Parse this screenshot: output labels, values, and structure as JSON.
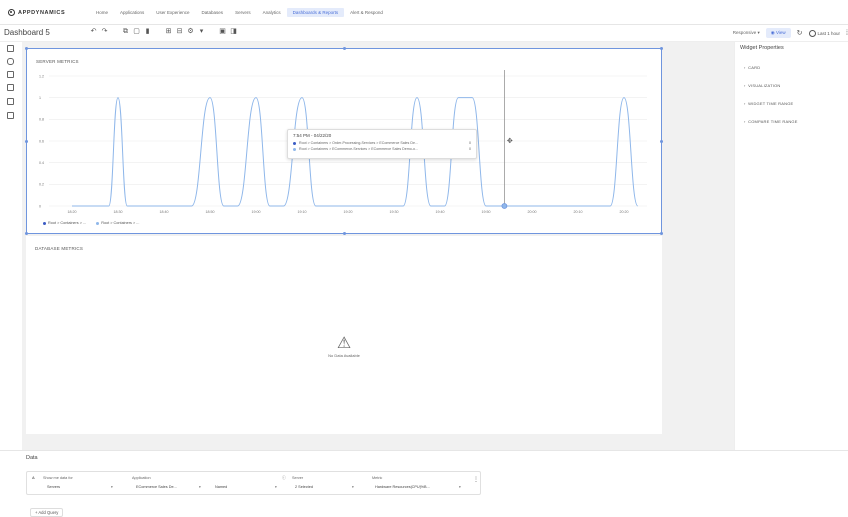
{
  "app": {
    "logo_text": "APPDYNAMICS"
  },
  "nav": {
    "items": [
      "Home",
      "Applications",
      "User Experience",
      "Databases",
      "Servers",
      "Analytics",
      "Dashboards & Reports",
      "Alert & Respond"
    ],
    "active_index": 6
  },
  "toolbar": {
    "dashboard_title": "Dashboard 5",
    "responsive_label": "Responsive",
    "view_label": "View",
    "timerange_label": "Last 1 hour"
  },
  "widgets": {
    "server": {
      "title": "SERVER METRICS",
      "tooltip": {
        "time": "7:54 PM - 04/22/20",
        "rows": [
          {
            "label": "Root > Containers > Order-Processing-Services > ECommerce Sales De...",
            "value": "0",
            "color": "#3b5cc4"
          },
          {
            "label": "Root > Containers > ECommerce-Services > ECommerce Sales Demo-o...",
            "value": "0",
            "color": "#8fb7ea"
          }
        ]
      },
      "legend": [
        {
          "label": "Root > Containers > ...",
          "color": "#3b5cc4"
        },
        {
          "label": "Root > Containers > ...",
          "color": "#8fb7ea"
        }
      ]
    },
    "database": {
      "title": "DATABASE METRICS",
      "no_data_text": "No Data Available"
    }
  },
  "chart_data": {
    "type": "line",
    "y_ticks": [
      "1.2",
      "1",
      "0.8",
      "0.6",
      "0.4",
      "0.2",
      "0"
    ],
    "ylim": [
      0,
      1.2
    ],
    "x_ticks": [
      "18:20",
      "18:30",
      "18:40",
      "18:50",
      "19:00",
      "19:10",
      "19:20",
      "19:30",
      "19:40",
      "19:50",
      "20:00",
      "20:10",
      "20:20"
    ],
    "grid": true,
    "series": [
      {
        "name": "Root > Containers > ...",
        "x": [
          "18:20",
          "18:24",
          "18:28",
          "18:30",
          "18:32",
          "18:46",
          "18:50",
          "18:53",
          "18:56",
          "19:00",
          "19:03",
          "19:06",
          "19:10",
          "19:13",
          "19:16",
          "19:32",
          "19:35",
          "19:38",
          "19:41",
          "19:44",
          "19:47",
          "19:50",
          "19:53",
          "20:17",
          "20:20",
          "20:23"
        ],
        "values": [
          0,
          0,
          0,
          1,
          0,
          0,
          1,
          0,
          0,
          1,
          0,
          0,
          1,
          0,
          0,
          0,
          1,
          0,
          0,
          1,
          1,
          0,
          0,
          0,
          1,
          0
        ]
      }
    ],
    "cursor_time": "19:54"
  },
  "right_panel": {
    "title": "Widget Properties",
    "items": [
      "CARD",
      "VISUALIZATION",
      "WIDGET TIME RANGE",
      "COMPARE TIME RANGE"
    ]
  },
  "data_panel": {
    "title": "Data",
    "query": {
      "id": "A",
      "show_me_label": "Show me data for",
      "show_me_value": "Servers",
      "application_label": "Application",
      "application_value": "ECommerce Sales De...",
      "application_sub": "Named",
      "server_label": "Server",
      "server_value": "2 Selected",
      "metric_label": "Metric",
      "metric_value": "Hardware Resources|CPU|%B..."
    },
    "add_query_label": "+ Add Query"
  }
}
